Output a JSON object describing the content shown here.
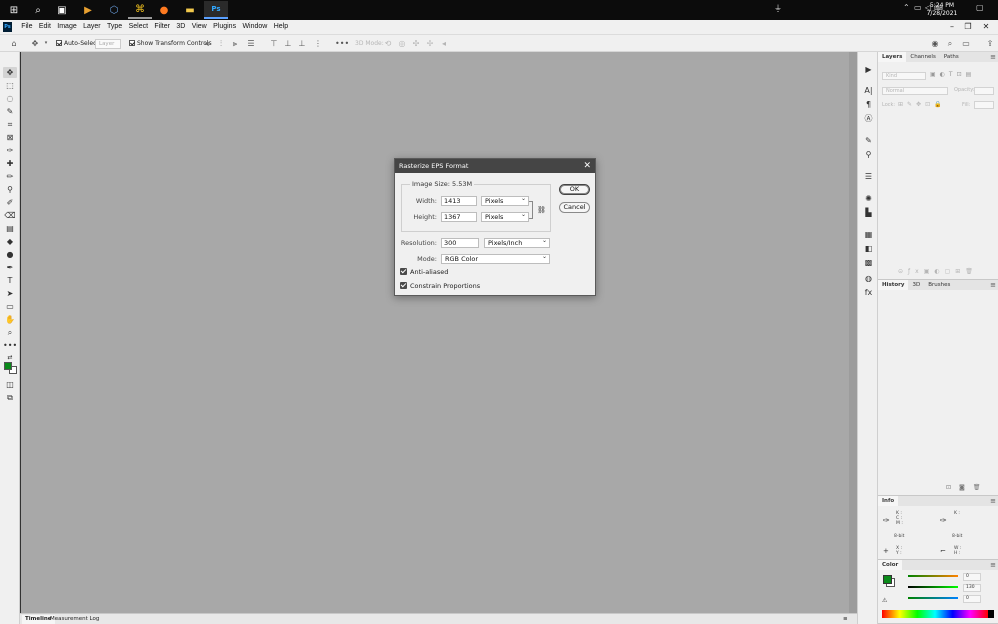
{
  "taskbar": {
    "apps": [
      {
        "name": "windows-start-icon",
        "glyph": "⊞"
      },
      {
        "name": "search-icon",
        "glyph": "⌕"
      },
      {
        "name": "task-view-icon",
        "glyph": "▣"
      },
      {
        "name": "media-player-icon",
        "glyph": "▶"
      },
      {
        "name": "app-icon",
        "glyph": "⬡"
      },
      {
        "name": "folder-app-icon",
        "glyph": "⌘"
      },
      {
        "name": "firefox-icon",
        "glyph": "●"
      },
      {
        "name": "file-explorer-icon",
        "glyph": "▬"
      },
      {
        "name": "photoshop-taskbar-icon",
        "glyph": "Ps"
      }
    ],
    "time": "5:24 PM",
    "date": "7/28/2021"
  },
  "menubar": {
    "logo": "Ps",
    "items": [
      "File",
      "Edit",
      "Image",
      "Layer",
      "Type",
      "Select",
      "Filter",
      "3D",
      "View",
      "Plugins",
      "Window",
      "Help"
    ]
  },
  "options": {
    "auto_select": "Auto-Select",
    "layer_dropdown": "Layer",
    "show_transform": "Show Transform Controls",
    "mode_3d": "3D Mode:"
  },
  "right_panels": {
    "layers_tabs": [
      "Layers",
      "Channels",
      "Paths"
    ],
    "kind_placeholder": "Kind",
    "blend_mode": "Normal",
    "opacity_label": "Opacity:",
    "lock_label": "Lock:",
    "fill_label": "Fill:",
    "history_tabs": [
      "History",
      "3D",
      "Brushes"
    ],
    "info_tab": "Info",
    "info_k1": "K :",
    "info_k2": "K :",
    "info_c": "C :",
    "info_m": "M :",
    "info_y": "Y :",
    "info_bit1": "8-bit",
    "info_bit2": "8-bit",
    "info_x": "X :",
    "info_yy": "Y :",
    "info_w": "W :",
    "info_h": "H :",
    "color_tab": "Color",
    "color_r": "0",
    "color_g": "130",
    "color_b": "0",
    "colors": {
      "foreground": "#0a8a1a"
    }
  },
  "bottom_tabs": [
    "Timeline",
    "Measurement Log"
  ],
  "dialog": {
    "title": "Rasterize EPS Format",
    "image_size_label": "Image Size: 5.53M",
    "width_label": "Width:",
    "width_value": "1413",
    "width_unit": "Pixels",
    "height_label": "Height:",
    "height_value": "1367",
    "height_unit": "Pixels",
    "resolution_label": "Resolution:",
    "resolution_value": "300",
    "resolution_unit": "Pixels/Inch",
    "mode_label": "Mode:",
    "mode_value": "RGB Color",
    "anti_aliased_label": "Anti-aliased",
    "constrain_label": "Constrain Proportions",
    "ok_label": "OK",
    "cancel_label": "Cancel"
  }
}
